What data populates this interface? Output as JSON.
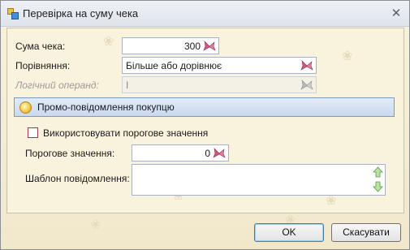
{
  "window": {
    "title": "Перевірка на суму чека",
    "close_glyph": "✕"
  },
  "form": {
    "sum_label": "Сума чека:",
    "sum_value": "300",
    "comparison_label": "Порівняння:",
    "comparison_value": "Більше або дорівнює",
    "logical_label": "Логічний операнд:",
    "logical_value": "І"
  },
  "promo_group": {
    "title": "Промо-повідомлення покупцю",
    "use_threshold_label": "Використовувати порогове значення",
    "use_threshold_checked": false,
    "threshold_label": "Порогове значення:",
    "threshold_value": "0",
    "template_label": "Шаблон повідомлення:",
    "template_value": ""
  },
  "buttons": {
    "ok_label": "OK",
    "cancel_label": "Скасувати"
  },
  "colors": {
    "background": "#f8f2dc",
    "group_header": "#c9d9ee",
    "pin_accent": "#d2567f"
  },
  "icons": {
    "window": "app-icon",
    "pin": "butterfly-icon",
    "group": "lightbulb-icon",
    "spin_up": "arrow-up-icon",
    "spin_down": "arrow-down-icon"
  }
}
